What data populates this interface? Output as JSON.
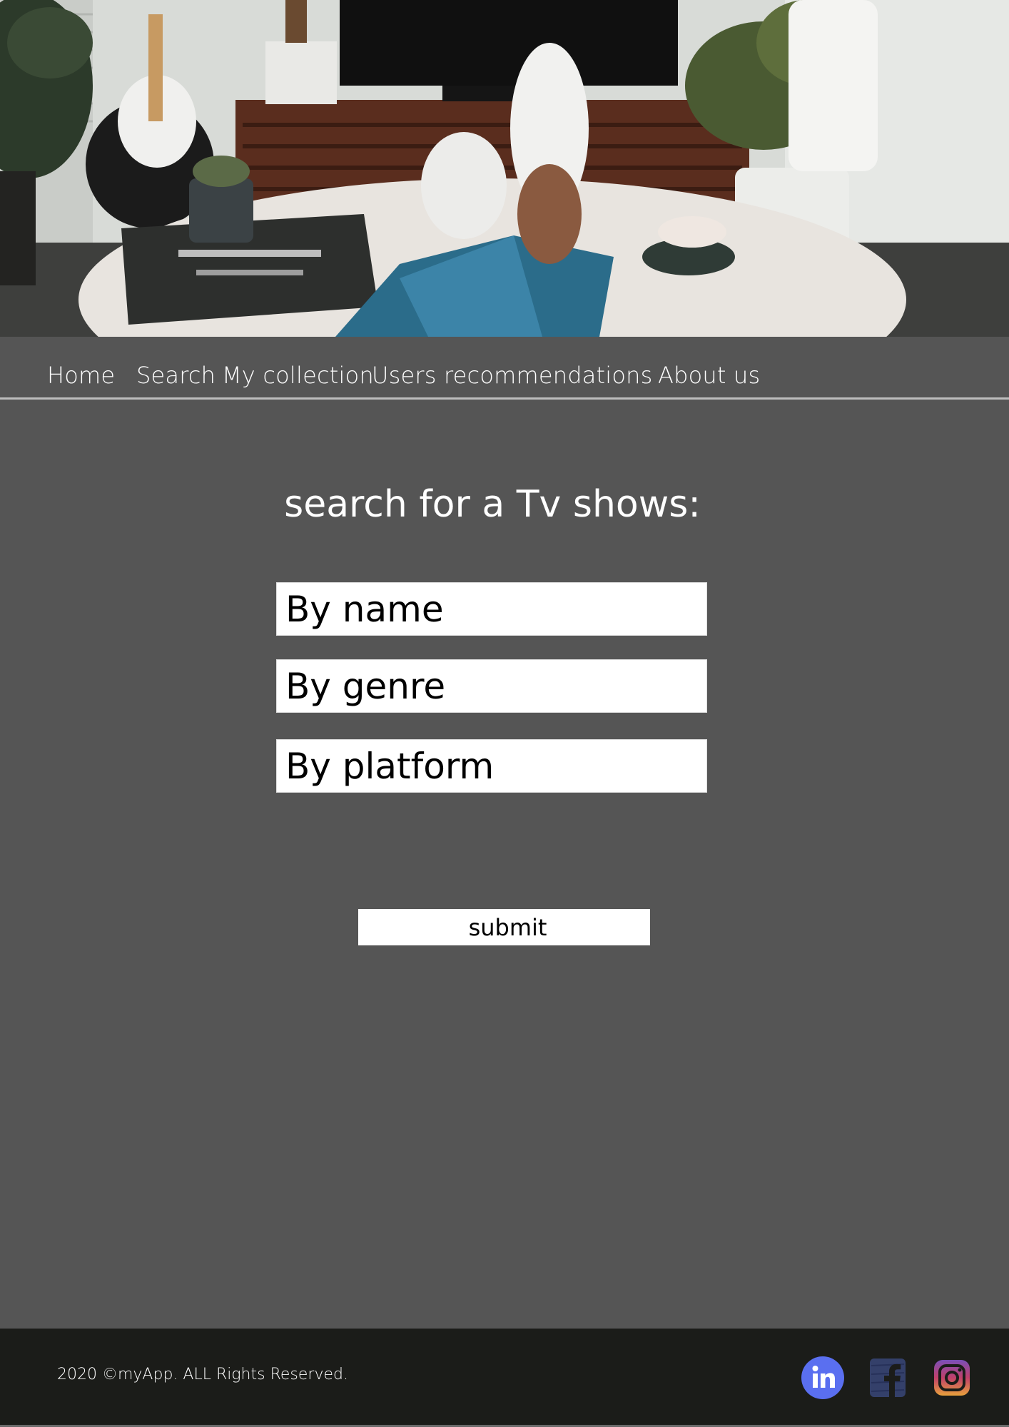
{
  "nav": {
    "items": [
      {
        "label": "Home"
      },
      {
        "label": "Search"
      },
      {
        "label": "My collection"
      },
      {
        "label": "Users recommendations"
      },
      {
        "label": "About us"
      }
    ]
  },
  "main": {
    "title": "search for a Tv shows:",
    "fields": {
      "name": {
        "placeholder": "By name"
      },
      "genre": {
        "placeholder": "By genre"
      },
      "platform": {
        "placeholder": "By platform"
      }
    },
    "submit_label": "submit"
  },
  "footer": {
    "copyright": "2020 ©myApp. ALL Rights Reserved.",
    "social": [
      {
        "icon": "linkedin-icon",
        "color": "#5a6ff0"
      },
      {
        "icon": "facebook-icon",
        "color": "#34406a"
      },
      {
        "icon": "instagram-icon",
        "color": "#c1406a"
      }
    ]
  },
  "colors": {
    "page_bg": "#555555",
    "footer_bg": "#1b1c19",
    "text": "#ffffff"
  }
}
